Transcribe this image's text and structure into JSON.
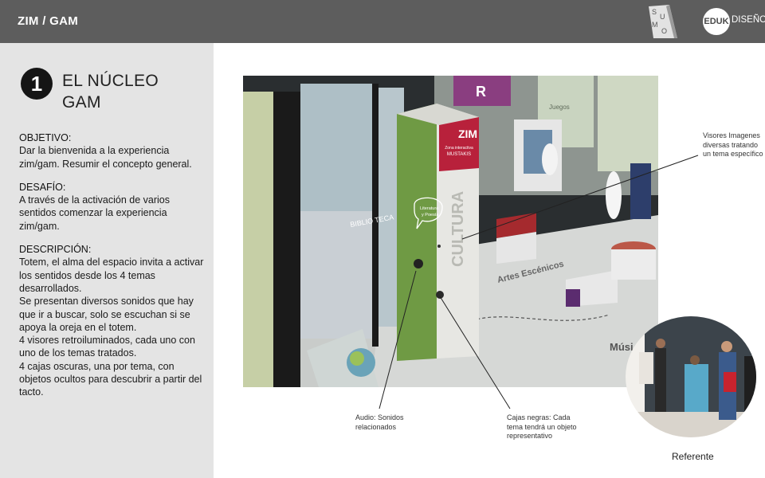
{
  "header": {
    "title": "ZIM / GAM",
    "sumo_letters": [
      "S",
      "U",
      "M",
      "O"
    ],
    "eduk_badge": "EDUK",
    "eduk_suffix": "DISEÑO"
  },
  "section": {
    "number": "1",
    "title_line1": "EL NÚCLEO",
    "title_line2": "GAM"
  },
  "objetivo": {
    "heading": "OBJETIVO:",
    "text": "Dar la bienvenida a la experiencia zim/gam. Resumir el concepto general."
  },
  "desafio": {
    "heading": "DESAFÍO:",
    "text": "A través de la activación de varios sentidos comenzar la experiencia zim/gam."
  },
  "descripcion": {
    "heading": "DESCRIPCIÓN:",
    "paragraphs": [
      "Totem, el alma del espacio invita a activar los sentidos desde los 4 temas desarrollados.",
      "Se presentan diversos sonidos que hay que ir a buscar, solo se escuchan si se apoya la oreja en el totem.",
      "4 visores retroiluminados, cada uno con uno de los temas tratados.",
      "4 cajas oscuras, una por tema, con objetos ocultos para descubrir a partir del tacto."
    ]
  },
  "render": {
    "totem_logo": "ZIM",
    "totem_subtitle_1": "Zona interactiva",
    "totem_subtitle_2": "MUSTAKIS",
    "totem_vertical_text": "CULTURA",
    "bubble_text_1": "Literatura",
    "bubble_text_2": "y Poesía",
    "floor_text_1": "Artes Escénicos",
    "floor_text_2": "Músi",
    "panel_text_biblioteca": "BIBLIO TECA",
    "top_banner_text": "R",
    "side_sign": "Juegos"
  },
  "callouts": {
    "visores": "Visores Imagenes diversas tratando un tema específico",
    "audio": "Audio: Sonidos relacionados",
    "cajas": "Cajas negras: Cada tema tendrá un objeto representativo"
  },
  "referente": {
    "label": "Referente"
  },
  "colors": {
    "header_bg": "#5d5d5d",
    "sidebar_bg": "#e4e4e4",
    "totem_green": "#6f9a44",
    "totem_red": "#b8213b",
    "badge_dark": "#151515"
  }
}
